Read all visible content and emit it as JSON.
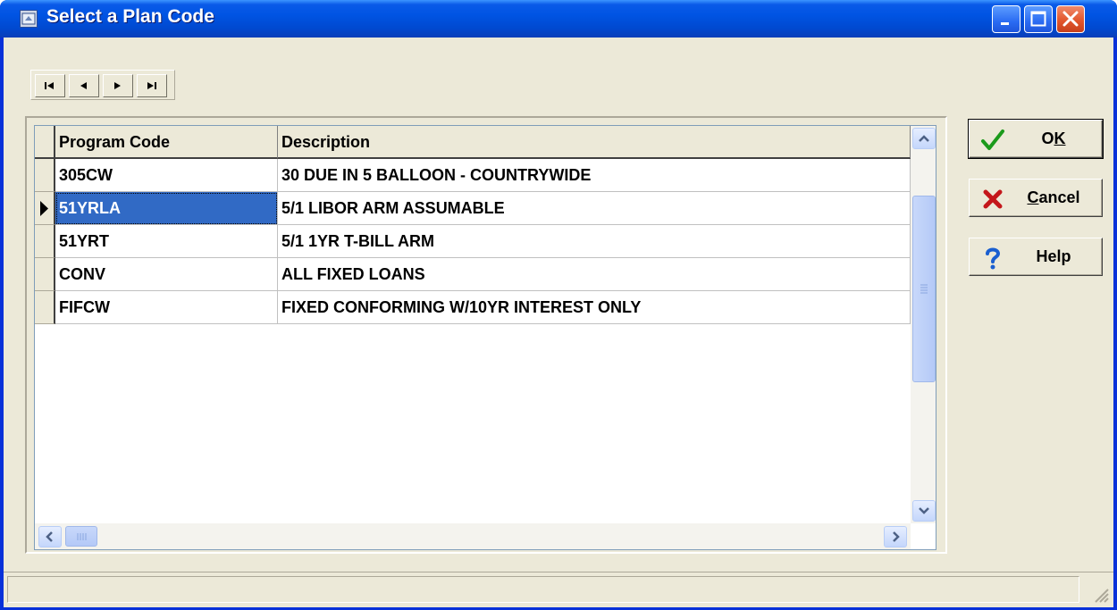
{
  "window": {
    "title": "Select a Plan Code",
    "icon": "app-window-icon"
  },
  "title_buttons": [
    "minimize",
    "maximize",
    "close"
  ],
  "navigator": {
    "buttons": [
      "first-record",
      "prior-record",
      "next-record",
      "last-record"
    ]
  },
  "grid": {
    "columns": [
      "Program Code",
      "Description"
    ],
    "rows": [
      {
        "code": "305CW",
        "description": "30 DUE IN 5 BALLOON - COUNTRYWIDE"
      },
      {
        "code": "51YRLA",
        "description": "5/1 LIBOR ARM ASSUMABLE"
      },
      {
        "code": "51YRT",
        "description": "5/1 1YR T-BILL ARM"
      },
      {
        "code": "CONV",
        "description": "ALL FIXED LOANS"
      },
      {
        "code": "FIFCW",
        "description": "FIXED CONFORMING W/10YR INTEREST ONLY"
      }
    ],
    "selected_row_index": 1
  },
  "buttons": {
    "ok": {
      "pre": "O",
      "accel": "K",
      "post": ""
    },
    "cancel": {
      "pre": "",
      "accel": "C",
      "post": "ancel"
    },
    "help": {
      "label": "Help"
    }
  },
  "colors": {
    "titlebar": "#0054e3",
    "selection": "#316ac5",
    "face": "#ece9d8"
  }
}
